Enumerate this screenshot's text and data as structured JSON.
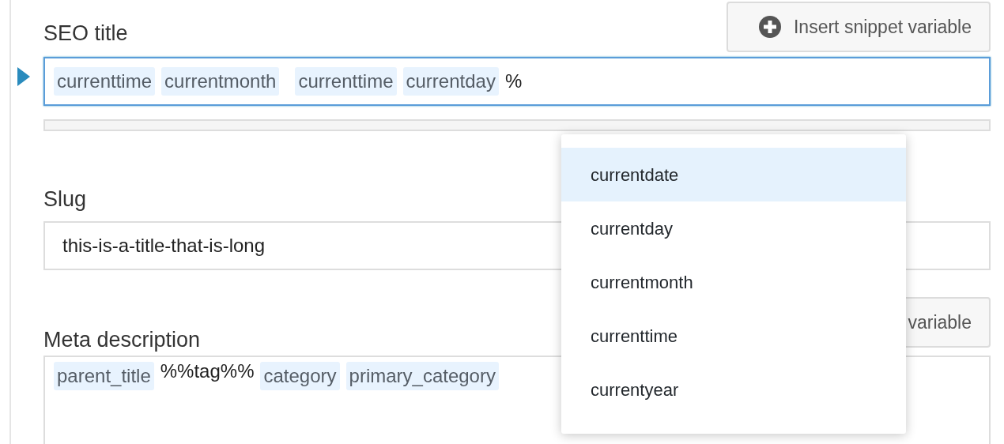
{
  "fields": [
    {
      "label": "SEO title",
      "focused": true,
      "button": "Insert snippet variable",
      "tokens": [
        {
          "kind": "variable",
          "text": "currenttime"
        },
        {
          "kind": "variable",
          "text": "currentmonth"
        },
        {
          "kind": "space"
        },
        {
          "kind": "variable",
          "text": "currenttime"
        },
        {
          "kind": "variable",
          "text": "currentday"
        },
        {
          "kind": "text",
          "text": "%"
        }
      ],
      "score_bar": {
        "level": 0
      }
    },
    {
      "label": "Slug",
      "focused": false,
      "value": "this-is-a-title-that-is-long"
    },
    {
      "label": "Meta description",
      "focused": false,
      "button": "variable",
      "tokens": [
        {
          "kind": "variable",
          "text": "parent_title"
        },
        {
          "kind": "text",
          "text": "%%tag%%"
        },
        {
          "kind": "variable",
          "text": "category"
        },
        {
          "kind": "variable",
          "text": "primary_category"
        }
      ],
      "kind": "textarea"
    }
  ],
  "dropdown": {
    "items": [
      {
        "label": "currentdate",
        "selected": true
      },
      {
        "label": "currentday",
        "selected": false
      },
      {
        "label": "currentmonth",
        "selected": false
      },
      {
        "label": "currenttime",
        "selected": false
      },
      {
        "label": "currentyear",
        "selected": false
      }
    ]
  }
}
